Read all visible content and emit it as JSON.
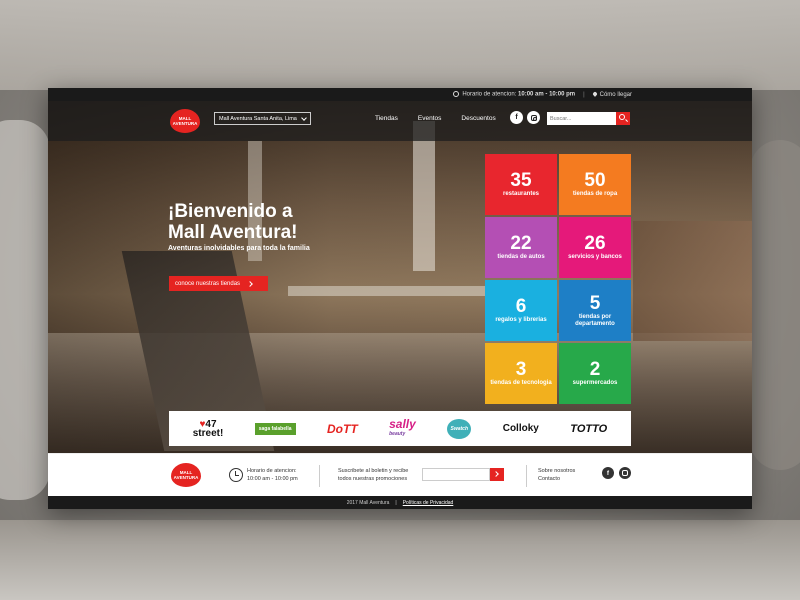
{
  "topbar": {
    "hours_label": "Horario de atencion:",
    "hours_value": "10:00 am - 10:00 pm",
    "directions": "Cómo llegar"
  },
  "nav": {
    "logo_text": "MALL AVENTURA",
    "mall_select": "Mall Aventura Santa Anita, Lima",
    "menu": [
      "Tiendas",
      "Eventos",
      "Descuentos"
    ],
    "search_placeholder": "Buscar..."
  },
  "hero": {
    "title_line1": "¡Bienvenido a",
    "title_line2": "Mall Aventura!",
    "subtitle": "Aventuras inolvidables para toda la familia",
    "cta": "conoce nuestras tiendas"
  },
  "tiles": [
    {
      "number": "35",
      "label": "restaurantes",
      "color": "#e8262e"
    },
    {
      "number": "50",
      "label": "tiendas de ropa",
      "color": "#f47b20"
    },
    {
      "number": "22",
      "label": "tiendas de autos",
      "color": "#b44fb4"
    },
    {
      "number": "26",
      "label": "servicios y bancos",
      "color": "#e5197a"
    },
    {
      "number": "6",
      "label": "regalos y librerias",
      "color": "#1ab0e0"
    },
    {
      "number": "5",
      "label": "tiendas por departamento",
      "color": "#1e7fc6"
    },
    {
      "number": "3",
      "label": "tiendas de tecnologia",
      "color": "#f2b01e"
    },
    {
      "number": "2",
      "label": "supermercados",
      "color": "#27a94a"
    }
  ],
  "brands": {
    "b47_top": "47",
    "b47_bottom": "street!",
    "saga": "saga falabella",
    "dott": "DoTT",
    "sally": "sally",
    "sally_sub": "beauty",
    "swatch": "Swatch",
    "colloky": "Colloky",
    "totto": "TOTTO"
  },
  "carousel": {
    "total": 10,
    "active": 0
  },
  "footer": {
    "hours_label": "Horario de atencion:",
    "hours_value": "10:00 am - 10:00 pm",
    "newsletter_line1": "Suscribete al boletin y recibe",
    "newsletter_line2": "todos nuestras promociones",
    "about": "Sobre nosotros",
    "contact": "Contacto"
  },
  "bottom": {
    "copyright": "2017 Mall Aventura",
    "privacy": "Políticas de Privacidad"
  },
  "colors": {
    "accent": "#e52421",
    "dark": "#1a1a1a"
  }
}
